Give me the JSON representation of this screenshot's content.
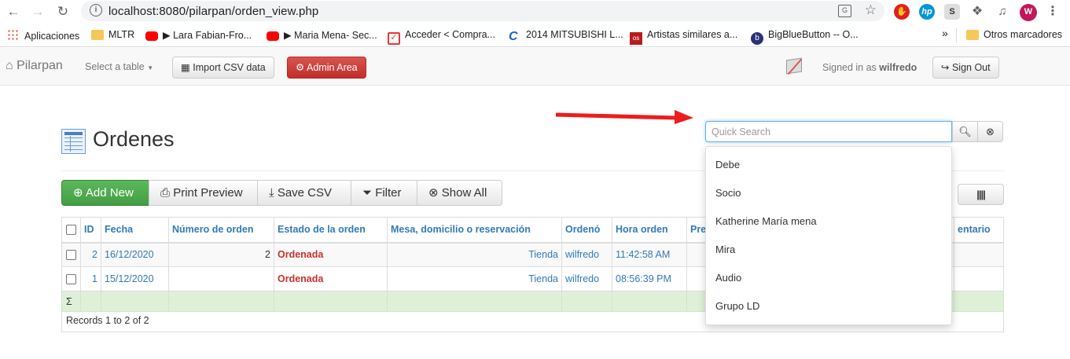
{
  "browser": {
    "url": "localhost:8080/pilarpan/orden_view.php",
    "profile_initial": "W",
    "bookmarks": [
      {
        "label": "Aplicaciones",
        "icon": "apps-grid-icon"
      },
      {
        "label": "MLTR",
        "icon": "folder-icon"
      },
      {
        "label": "Lara Fabian-Fro...",
        "icon": "youtube-icon"
      },
      {
        "label": "Maria Mena- Sec...",
        "icon": "youtube-icon"
      },
      {
        "label": "Acceder < Compra...",
        "icon": "checkbox-icon"
      },
      {
        "label": "2014 MITSUBISHI L...",
        "icon": "c-logo-icon"
      },
      {
        "label": "Artistas similares a...",
        "icon": "os-logo-icon"
      },
      {
        "label": "BigBlueButton -- O...",
        "icon": "bbb-logo-icon"
      },
      {
        "label": "Otros marcadores",
        "icon": "folder-icon"
      }
    ],
    "more": "»"
  },
  "app": {
    "brand": "Pilarpan",
    "select_table": "Select a table",
    "import_csv": "Import CSV data",
    "admin_area": "Admin Area",
    "signed_in_prefix": "Signed in as",
    "user": "wilfredo",
    "sign_out": "Sign Out"
  },
  "page": {
    "title": "Ordenes",
    "search_placeholder": "Quick Search",
    "search_suggestions": [
      "Debe",
      "Socio",
      "Katherine María mena",
      "Mira",
      "Audio",
      "Grupo LD"
    ],
    "toolbar": {
      "add_new": "Add New",
      "print_preview": "Print Preview",
      "save_csv": "Save CSV",
      "filter": "Filter",
      "show_all": "Show All"
    },
    "table": {
      "columns": [
        "ID",
        "Fecha",
        "Número de orden",
        "Estado de la orden",
        "Mesa, domicilio o reservación",
        "Ordenó",
        "Hora orden",
        "Prep",
        "entario"
      ],
      "rows": [
        {
          "id": "2",
          "fecha": "16/12/2020",
          "numero": "2",
          "estado": "Ordenada",
          "mesa": "Tienda",
          "ordeno": "wilfredo",
          "hora": "11:42:58 AM"
        },
        {
          "id": "1",
          "fecha": "15/12/2020",
          "numero": "",
          "estado": "Ordenada",
          "mesa": "Tienda",
          "ordeno": "wilfredo",
          "hora": "08:56:39 PM"
        }
      ],
      "sum_symbol": "Σ",
      "records": "Records 1 to 2 of 2"
    }
  },
  "colors": {
    "add_new": "#5cb85c",
    "admin": "#d9534f",
    "link": "#337ab7",
    "status": "#c9302c",
    "sum_row": "#dff0d8",
    "arrow": "#ee1c1c"
  }
}
